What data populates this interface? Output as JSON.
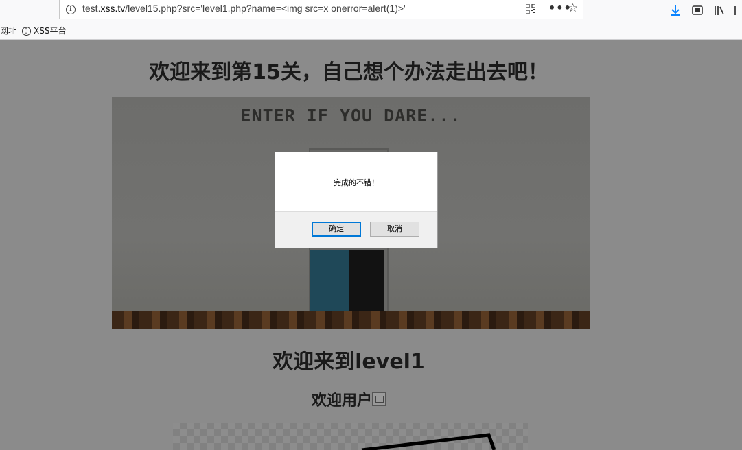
{
  "browser": {
    "url_prefix": "test.",
    "url_host": "xss.tv",
    "url_rest": "/level15.php?src='level1.php?name=<img src=x onerror=alert(1)>'",
    "bookmarks": [
      {
        "label": "网址"
      },
      {
        "label": "XSS平台"
      }
    ]
  },
  "page": {
    "title": "欢迎来到第15关，自己想个办法走出去吧！",
    "scene_text": "ENTER IF YOU DARE...",
    "level_heading": "欢迎来到level1",
    "user_heading": "欢迎用户"
  },
  "dialog": {
    "message": "完成的不错！",
    "ok_label": "确定",
    "cancel_label": "取消"
  },
  "colors": {
    "accent": "#0078d7",
    "download": "#0a84ff",
    "overlay_bg": "#8b8b8b"
  }
}
